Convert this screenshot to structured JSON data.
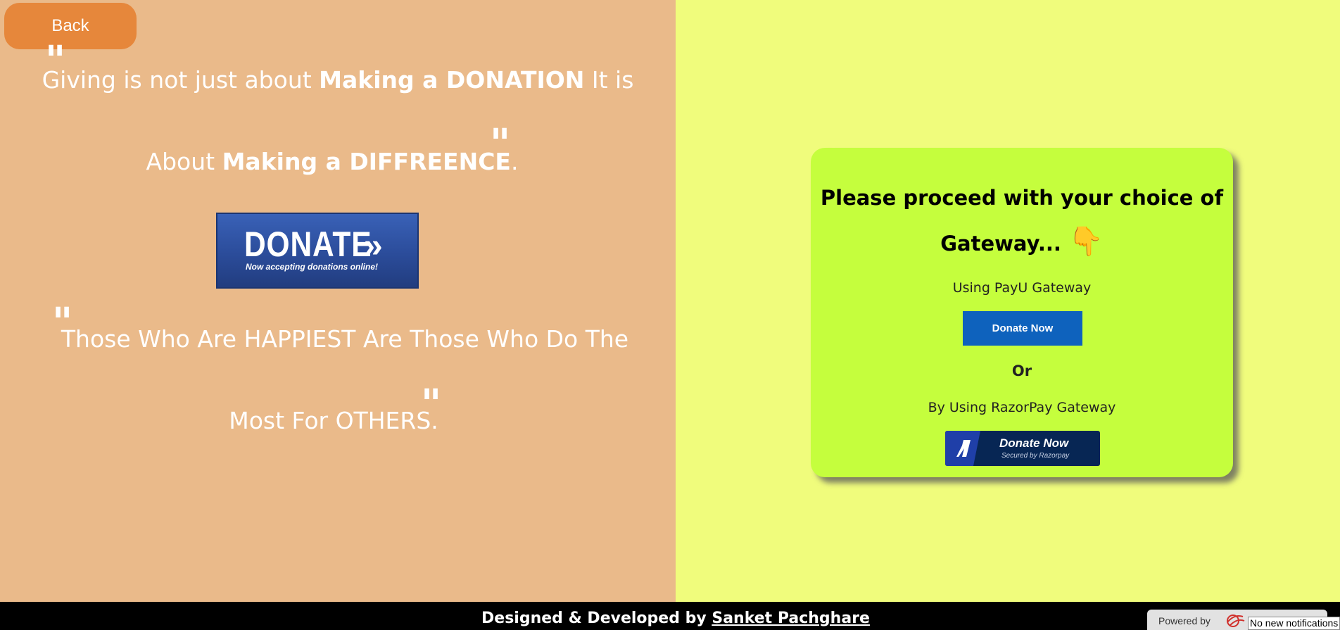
{
  "nav": {
    "back_label": "Back"
  },
  "quote1": {
    "part1": "Giving is not just about ",
    "bold1": "Making a DONATION",
    "part2": " It is",
    "part3": "About ",
    "bold2": "Making a DIFFREENCE",
    "part4": "."
  },
  "quote2": {
    "line1": "Those Who Are HAPPIEST Are Those Who Do The",
    "line2": "Most For OTHERS."
  },
  "quote_mark": "\"",
  "donate_banner": {
    "title": "DONATE",
    "chevron": "»",
    "subtitle": "Now accepting donations online!"
  },
  "gateway_card": {
    "title_line1": "Please proceed with your choice of",
    "title_line2": "Gateway...",
    "pointer_icon": "👇",
    "payu_label": "Using PayU Gateway",
    "payu_button": "Donate Now",
    "or_label": "Or",
    "razorpay_label": "By Using RazorPay Gateway",
    "razorpay_button": "Donate Now",
    "razorpay_sub": "Secured by Razorpay"
  },
  "footer": {
    "prefix": "Designed & Developed by ",
    "author": "Sanket Pachghare"
  },
  "widget": {
    "powered_label": "Powered by",
    "notification": "No new notifications"
  },
  "colors": {
    "left_bg": "#eaba8a",
    "right_bg": "#f0fc7c",
    "card_bg": "#c5fe3d",
    "back_btn": "#e6873b",
    "payu_btn": "#0e62bd",
    "razorpay_btn": "#072654"
  }
}
